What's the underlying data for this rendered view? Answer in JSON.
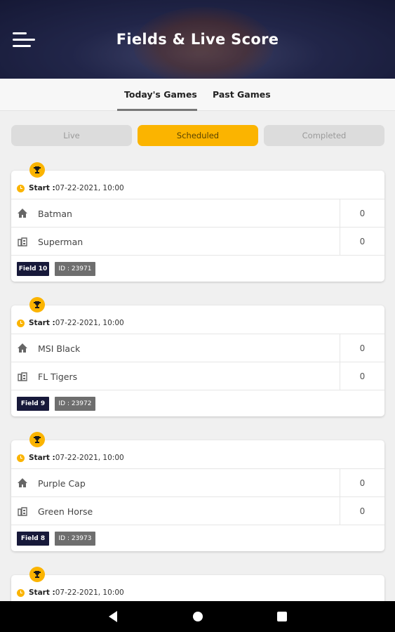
{
  "header": {
    "title": "Fields & Live Score",
    "menu_icon": "hamburger-menu-icon"
  },
  "tabs": [
    {
      "label": "Today's Games",
      "active": true
    },
    {
      "label": "Past Games",
      "active": false
    }
  ],
  "filters": [
    {
      "label": "Live",
      "active": false
    },
    {
      "label": "Scheduled",
      "active": true
    },
    {
      "label": "Completed",
      "active": false
    }
  ],
  "colors": {
    "accent": "#fbb400",
    "header_bg": "#2c3158",
    "field_badge": "#17193a",
    "id_badge": "#6e6e6e"
  },
  "games": [
    {
      "start_label": "Start :",
      "start_value": "07-22-2021, 10:00",
      "home_team": "Batman",
      "home_score": "0",
      "away_team": "Superman",
      "away_score": "0",
      "field": "Field 10",
      "game_id": "ID : 23971"
    },
    {
      "start_label": "Start :",
      "start_value": "07-22-2021, 10:00",
      "home_team": "MSI Black",
      "home_score": "0",
      "away_team": "FL Tigers",
      "away_score": "0",
      "field": "Field 9",
      "game_id": "ID : 23972"
    },
    {
      "start_label": "Start :",
      "start_value": "07-22-2021, 10:00",
      "home_team": "Purple Cap",
      "home_score": "0",
      "away_team": "Green Horse",
      "away_score": "0",
      "field": "Field 8",
      "game_id": "ID : 23973"
    },
    {
      "start_label": "Start :",
      "start_value": "07-22-2021, 10:00"
    }
  ],
  "navbar": {
    "back_icon": "back-triangle-icon",
    "home_icon": "home-circle-icon",
    "recents_icon": "recents-square-icon"
  }
}
